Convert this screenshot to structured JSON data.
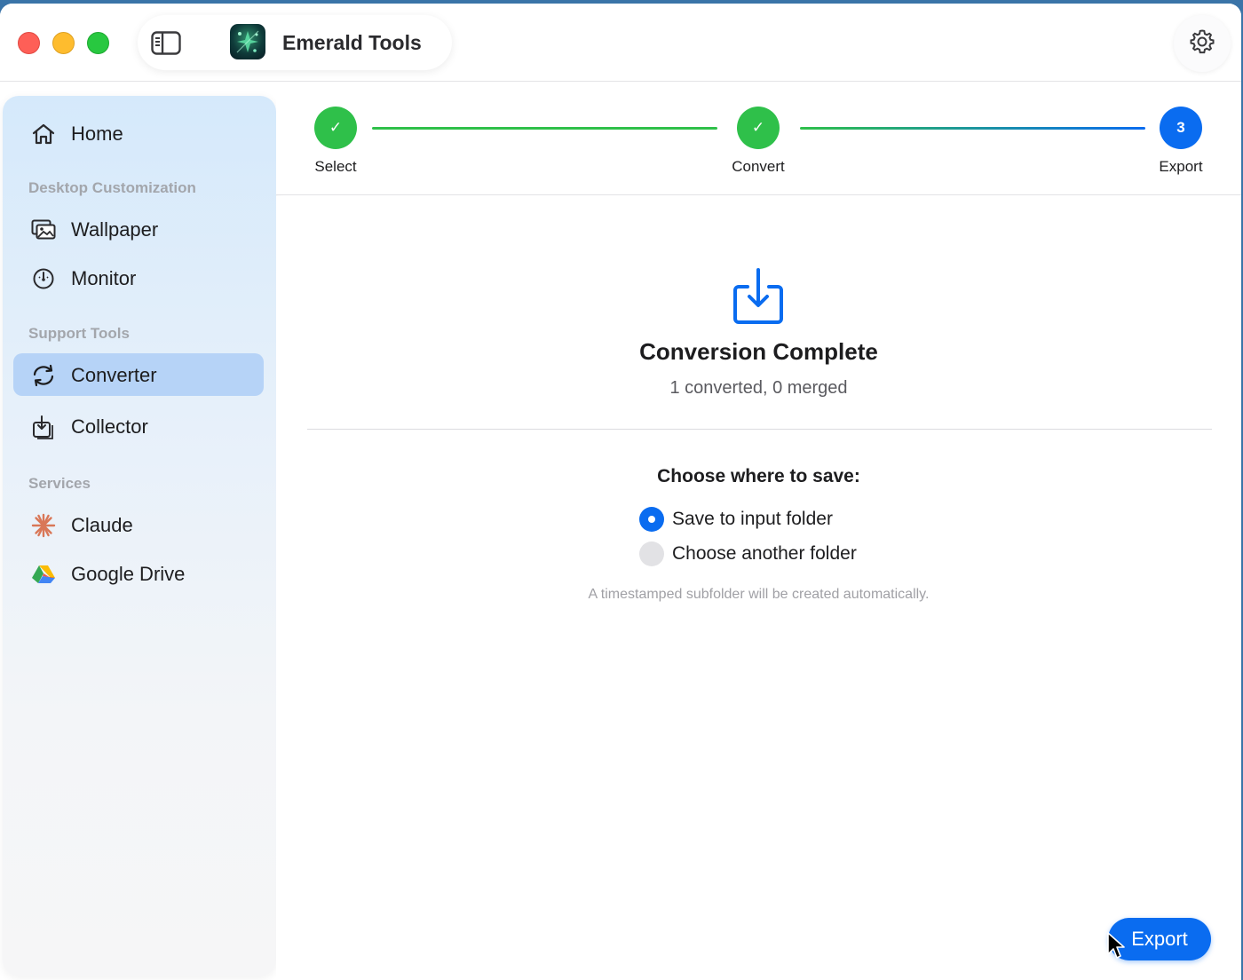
{
  "window": {
    "title": "Emerald Tools"
  },
  "sidebar": {
    "home_label": "Home",
    "sections": [
      {
        "label": "Desktop Customization"
      },
      {
        "label": "Support Tools"
      },
      {
        "label": "Services"
      }
    ],
    "items": [
      {
        "label": "Wallpaper",
        "icon": "wallpaper-icon"
      },
      {
        "label": "Monitor",
        "icon": "monitor-gauge-icon"
      },
      {
        "label": "Converter",
        "icon": "converter-arrows-icon",
        "active": true
      },
      {
        "label": "Collector",
        "icon": "collector-tray-icon"
      },
      {
        "label": "Claude",
        "icon": "claude-asterisk-icon"
      },
      {
        "label": "Google Drive",
        "icon": "google-drive-icon"
      }
    ]
  },
  "stepper": {
    "steps": [
      {
        "label": "Select",
        "state": "done",
        "mark": "✓"
      },
      {
        "label": "Convert",
        "state": "done",
        "mark": "✓"
      },
      {
        "label": "Export",
        "state": "current",
        "mark": "3"
      }
    ]
  },
  "main": {
    "title": "Conversion Complete",
    "subtitle": "1 converted, 0 merged",
    "choose_title": "Choose where to save:",
    "options": [
      {
        "label": "Save to input folder",
        "selected": true
      },
      {
        "label": "Choose another folder",
        "selected": false
      }
    ],
    "hint": "A timestamped subfolder will be created automatically.",
    "export_label": "Export"
  },
  "colors": {
    "accent": "#0a6cf0",
    "success": "#2fc04a",
    "sidebar_active": "#b6d3f7"
  }
}
